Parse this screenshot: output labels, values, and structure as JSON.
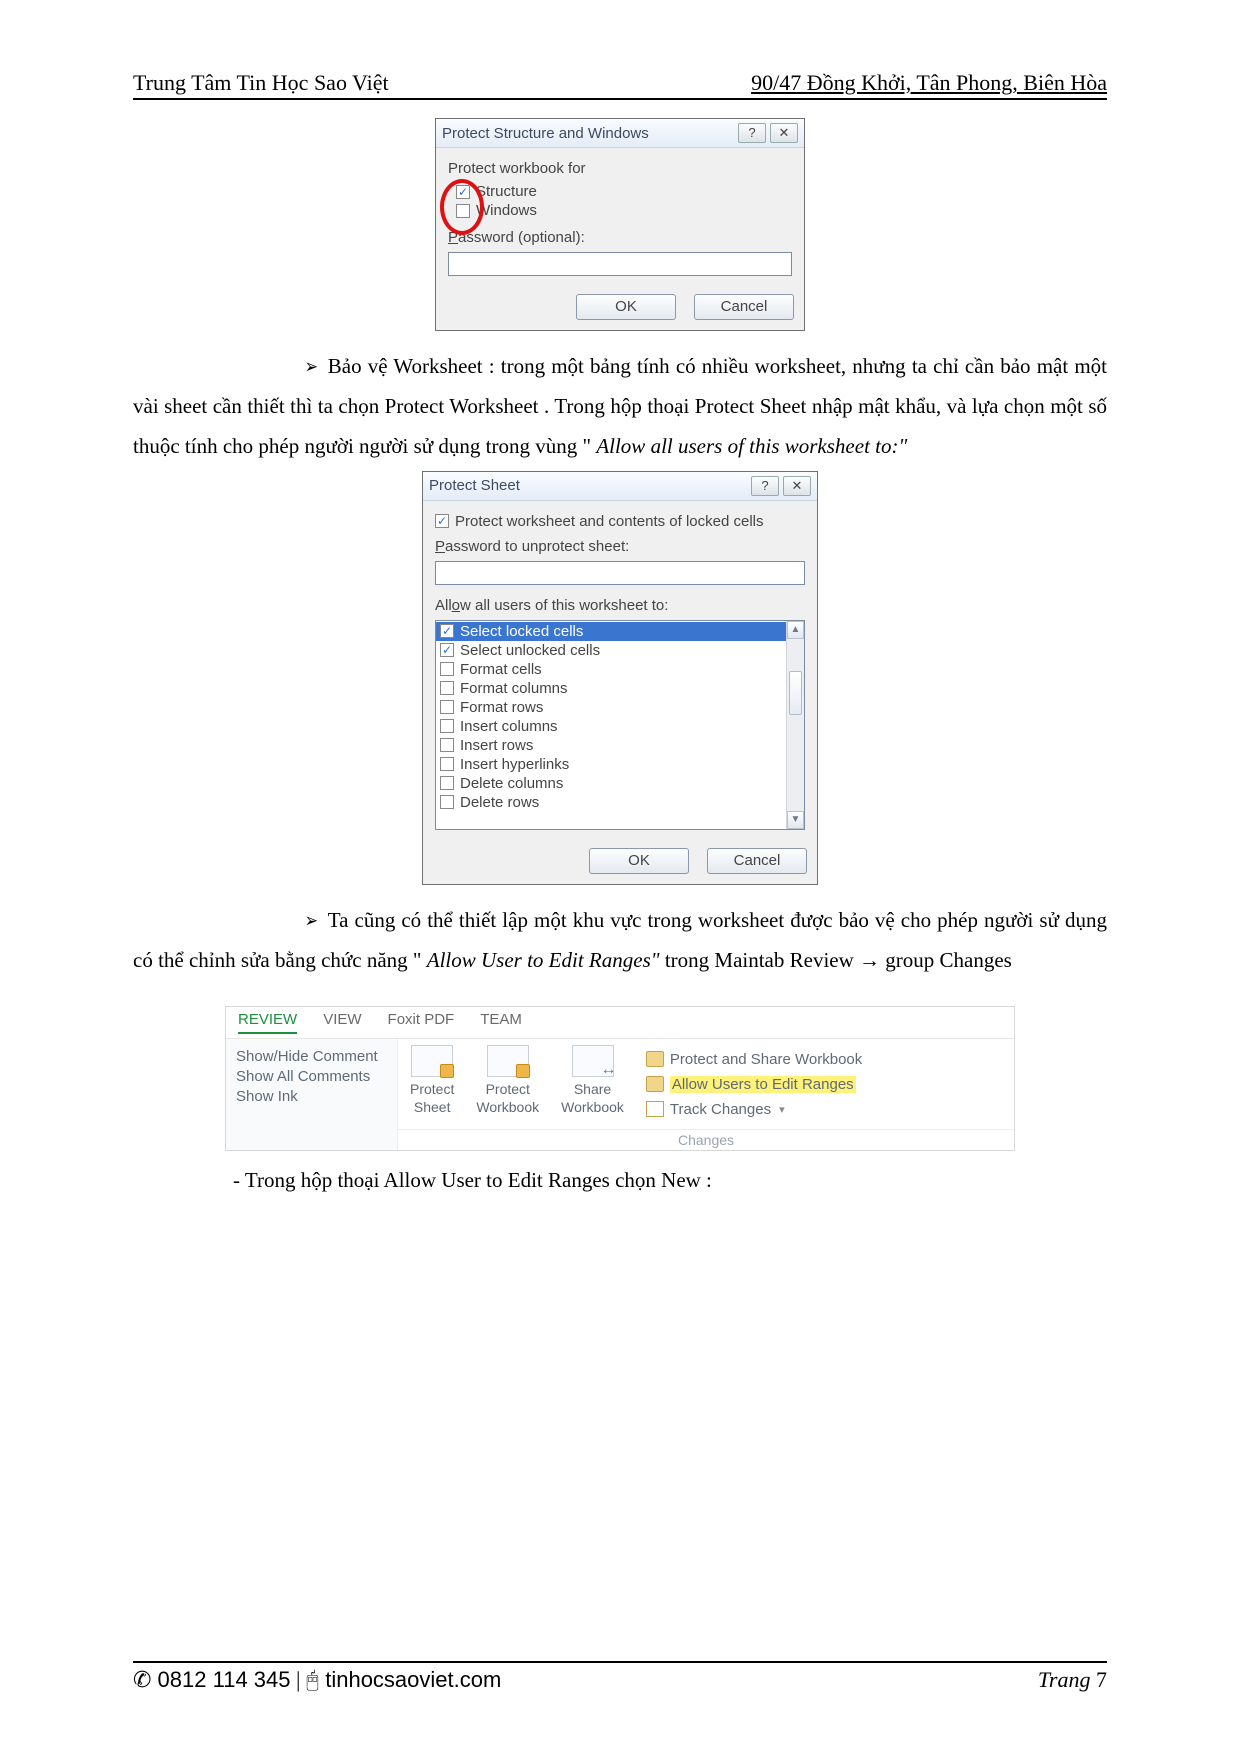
{
  "header": {
    "left": "Trung Tâm Tin Học Sao Việt",
    "right": "90/47 Đồng Khởi, Tân Phong, Biên Hòa"
  },
  "dialog1": {
    "title": "Protect Structure and Windows",
    "help_btn": "?",
    "close_btn": "✕",
    "label_protect_for": "Protect workbook for",
    "cb_structure": "Structure",
    "cb_windows": "Windows",
    "label_password": "Password (optional):",
    "ok": "OK",
    "cancel": "Cancel"
  },
  "para1": {
    "bullet": "➢",
    "lead": "Bảo vệ Worksheet : trong một bảng tính có nhiều worksheet, nhưng ta chỉ cần bảo mật một vài sheet cần thiết thì ta chọn Protect Worksheet . Trong hộp thoại Protect Sheet nhập mật khẩu, và lựa chọn một số thuộc tính cho phép người người sử dụng trong vùng \" ",
    "italic": "Allow all users of this worksheet to:\""
  },
  "dialog2": {
    "title": "Protect Sheet",
    "help_btn": "?",
    "close_btn": "✕",
    "cb_master": "Protect worksheet and contents of locked cells",
    "label_password": "Password to unprotect sheet:",
    "label_allow": "Allow all users of this worksheet to:",
    "items": [
      {
        "label": "Select locked cells",
        "checked": true,
        "selected": true
      },
      {
        "label": "Select unlocked cells",
        "checked": true,
        "selected": false
      },
      {
        "label": "Format cells",
        "checked": false,
        "selected": false
      },
      {
        "label": "Format columns",
        "checked": false,
        "selected": false
      },
      {
        "label": "Format rows",
        "checked": false,
        "selected": false
      },
      {
        "label": "Insert columns",
        "checked": false,
        "selected": false
      },
      {
        "label": "Insert rows",
        "checked": false,
        "selected": false
      },
      {
        "label": "Insert hyperlinks",
        "checked": false,
        "selected": false
      },
      {
        "label": "Delete columns",
        "checked": false,
        "selected": false
      },
      {
        "label": "Delete rows",
        "checked": false,
        "selected": false
      }
    ],
    "ok": "OK",
    "cancel": "Cancel"
  },
  "para2": {
    "bullet": "➢",
    "lead1": "Ta cũng có thể thiết lập một khu vực trong worksheet được bảo vệ cho phép người sử dụng có thể chỉnh sửa bằng chức năng \" ",
    "italic": "Allow User to Edit Ranges\"",
    "lead2": " trong Maintab Review → group Changes"
  },
  "ribbon": {
    "tabs": [
      "REVIEW",
      "VIEW",
      "Foxit PDF",
      "TEAM"
    ],
    "active_tab": "REVIEW",
    "left": {
      "l1": "Show/Hide Comment",
      "l2": "Show All Comments",
      "l3": "Show Ink"
    },
    "mid": [
      {
        "l1": "Protect",
        "l2": "Sheet"
      },
      {
        "l1": "Protect",
        "l2": "Workbook"
      },
      {
        "l1": "Share",
        "l2": "Workbook"
      }
    ],
    "right": {
      "r1": "Protect and Share Workbook",
      "r2": "Allow Users to Edit Ranges",
      "r3": "Track Changes"
    },
    "group": "Changes"
  },
  "para3": "-    Trong hộp thoại Allow User to Edit Ranges chọn New :",
  "footer": {
    "phone": "✆ 0812 114 345",
    "sep": "  |  ",
    "site": "🖰 tinhocsaoviet.com",
    "page_label": "Trang ",
    "page_num": "7"
  }
}
